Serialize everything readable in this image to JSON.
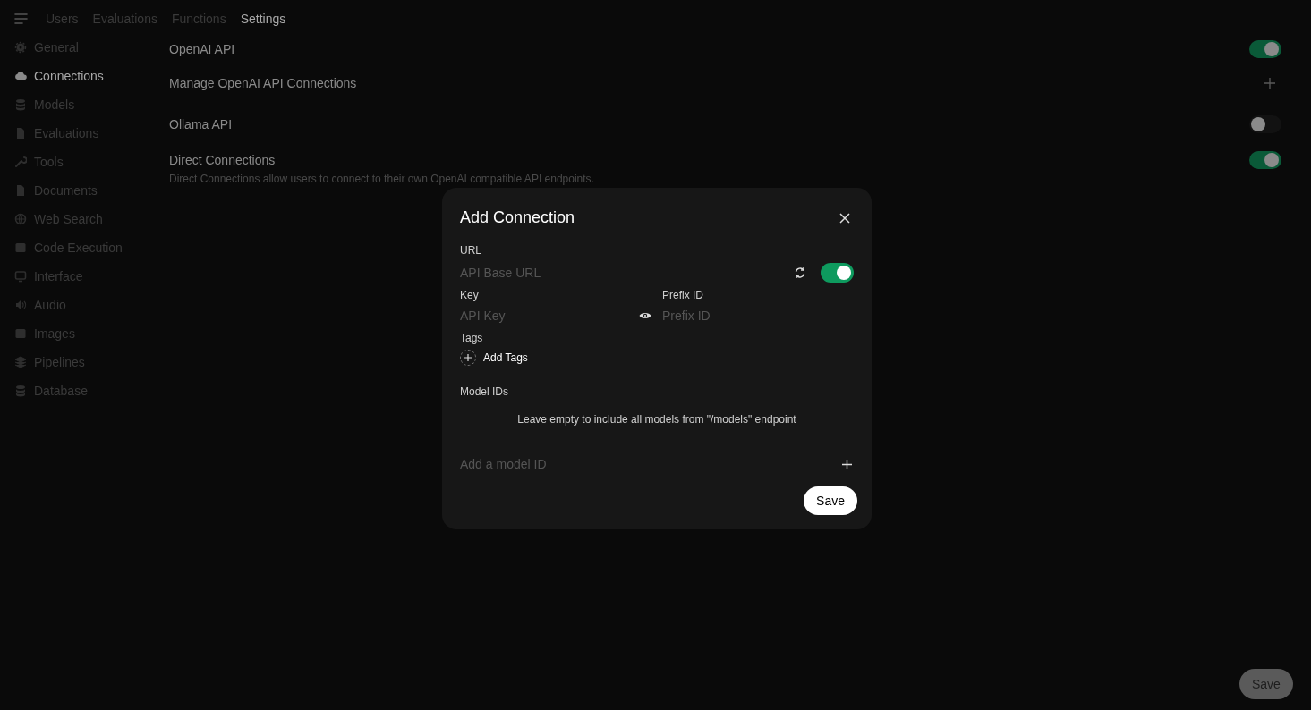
{
  "nav": {
    "tabs": [
      {
        "label": "Users",
        "selected": false
      },
      {
        "label": "Evaluations",
        "selected": false
      },
      {
        "label": "Functions",
        "selected": false
      },
      {
        "label": "Settings",
        "selected": true
      }
    ]
  },
  "sidebar": {
    "items": [
      {
        "label": "General",
        "selected": false
      },
      {
        "label": "Connections",
        "selected": true
      },
      {
        "label": "Models",
        "selected": false
      },
      {
        "label": "Evaluations",
        "selected": false
      },
      {
        "label": "Tools",
        "selected": false
      },
      {
        "label": "Documents",
        "selected": false
      },
      {
        "label": "Web Search",
        "selected": false
      },
      {
        "label": "Code Execution",
        "selected": false
      },
      {
        "label": "Interface",
        "selected": false
      },
      {
        "label": "Audio",
        "selected": false
      },
      {
        "label": "Images",
        "selected": false
      },
      {
        "label": "Pipelines",
        "selected": false
      },
      {
        "label": "Database",
        "selected": false
      }
    ]
  },
  "settings": {
    "rows": [
      {
        "kind": "toggle",
        "label": "OpenAI API",
        "on": true
      },
      {
        "kind": "add",
        "label": "Manage OpenAI API Connections"
      },
      {
        "kind": "toggle",
        "label": "Ollama API",
        "on": false
      },
      {
        "kind": "toggle",
        "label": "Direct Connections",
        "on": true,
        "description": "Direct Connections allow users to connect to their own OpenAI compatible API endpoints."
      }
    ]
  },
  "dialog": {
    "title": "Add Connection",
    "url": {
      "label": "URL",
      "placeholder": "API Base URL",
      "enabled": true
    },
    "key": {
      "label": "Key",
      "placeholder": "API Key"
    },
    "prefix": {
      "label": "Prefix ID",
      "placeholder": "Prefix ID"
    },
    "tags": {
      "label": "Tags",
      "button": "Add Tags"
    },
    "model_ids": {
      "label": "Model IDs",
      "hint": "Leave empty to include all models from \"/models\" endpoint",
      "placeholder": "Add a model ID"
    },
    "save": "Save"
  },
  "page_save": "Save"
}
